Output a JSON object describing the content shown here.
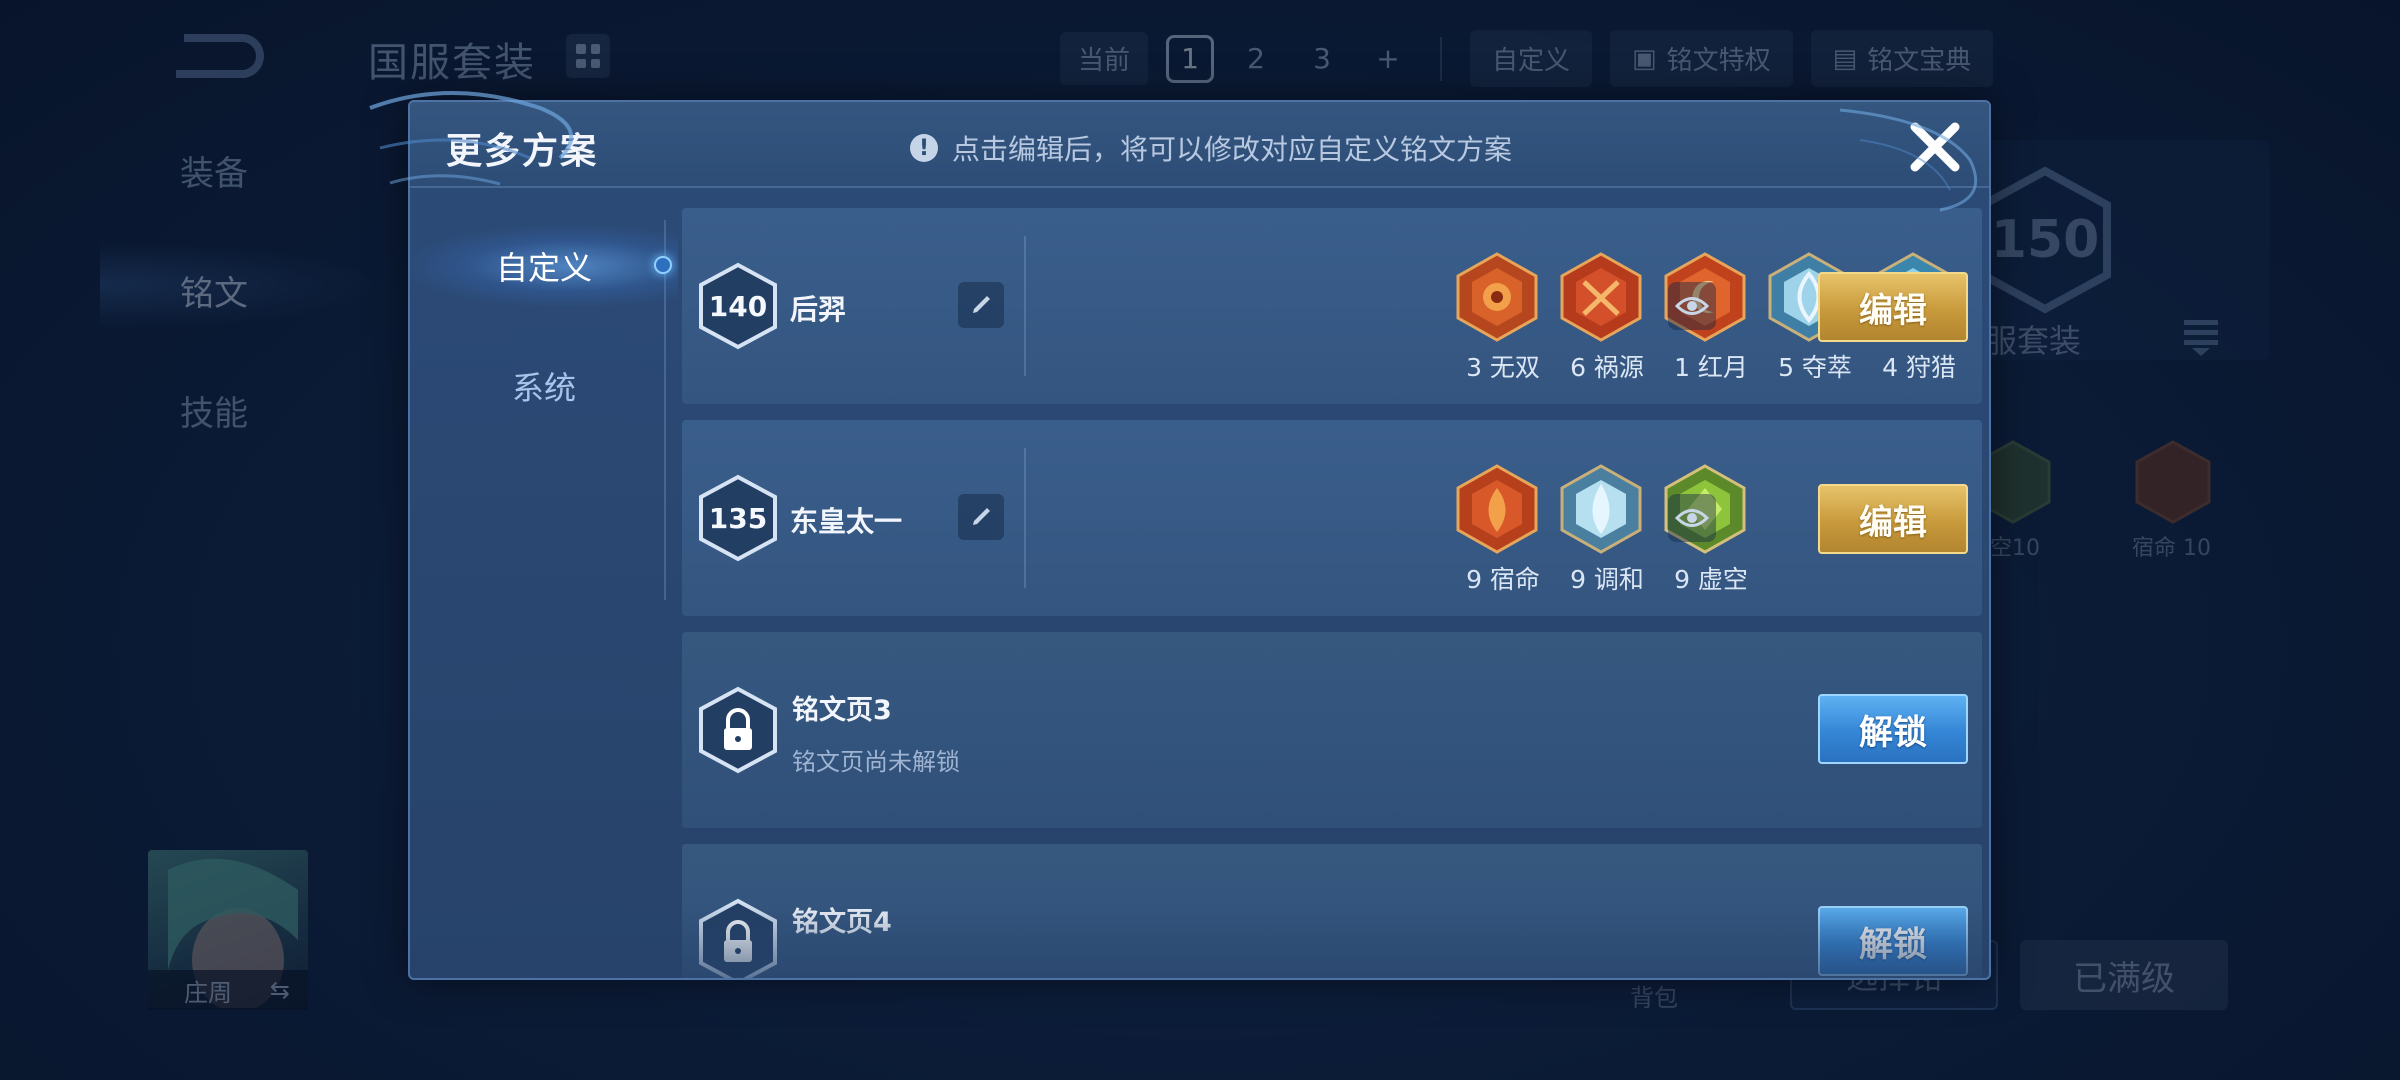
{
  "background": {
    "screen_title": "国服套装",
    "topbar": {
      "current_label": "当前",
      "pages": [
        "1",
        "2",
        "3"
      ],
      "add_label": "+",
      "custom_label": "自定义",
      "rune_special_label": "铭文特权",
      "rune_guide_label": "铭文宝典"
    },
    "side_nav": [
      "装备",
      "铭文",
      "技能"
    ],
    "set_level": "150",
    "set_label": "服套装",
    "runes": [
      {
        "label": "空10"
      },
      {
        "label": "宿命 10"
      }
    ],
    "hero_name": "庄周",
    "bag_label": "背包",
    "select_button": "选择铭",
    "maxed_button": "已满级"
  },
  "modal": {
    "title": "更多方案",
    "tip": "点击编辑后，将可以修改对应自定义铭文方案",
    "tabs": [
      {
        "label": "自定义",
        "active": true
      },
      {
        "label": "系统",
        "active": false
      }
    ],
    "plans": [
      {
        "level": "140",
        "name": "后羿",
        "runes": [
          {
            "count": "3",
            "name": "无双",
            "color": "red"
          },
          {
            "count": "6",
            "name": "祸源",
            "color": "red"
          },
          {
            "count": "1",
            "name": "红月",
            "color": "red"
          },
          {
            "count": "5",
            "name": "夺萃",
            "color": "blue"
          },
          {
            "count": "4",
            "name": "狩猎",
            "color": "blue"
          }
        ],
        "edit_label": "编辑"
      },
      {
        "level": "135",
        "name": "东皇太一",
        "runes": [
          {
            "count": "9",
            "name": "宿命",
            "color": "red"
          },
          {
            "count": "9",
            "name": "调和",
            "color": "blue"
          },
          {
            "count": "9",
            "name": "虚空",
            "color": "green"
          }
        ],
        "edit_label": "编辑"
      }
    ],
    "locked_pages": [
      {
        "title": "铭文页3",
        "subtitle": "铭文页尚未解锁",
        "unlock_label": "解锁"
      },
      {
        "title": "铭文页4",
        "unlock_label": "解锁"
      }
    ]
  },
  "colors": {
    "gold_button": "#d4a84e",
    "blue_button": "#3a8ee0",
    "modal_bg": "#2a4770"
  }
}
